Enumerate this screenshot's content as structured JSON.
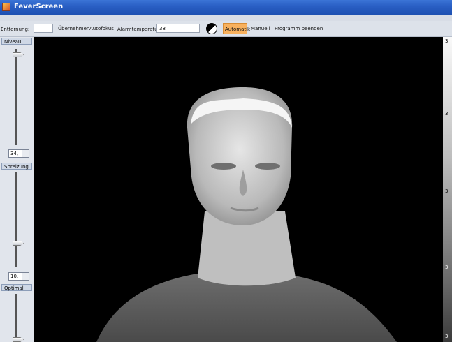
{
  "window": {
    "title": "FeverScreen"
  },
  "toolbar": {
    "distance_label": "Entfernung:",
    "distance_value": "",
    "apply_label": "Übernehmen",
    "autofocus_label": "Autofokus",
    "alarm_label": "Alarmtemperatur:",
    "alarm_value": "38",
    "automatic_label": "Automatik",
    "manual_label": "Manuell",
    "quit_label": "Programm beenden",
    "contrast_icon": "contrast-icon"
  },
  "sidebar": {
    "niveau": {
      "label": "Niveau",
      "value": "34,"
    },
    "spreizung": {
      "label": "Spreizung",
      "value": "10,"
    },
    "optimal": {
      "label": "Optimal"
    }
  },
  "scale": {
    "ticks": [
      "3",
      "3",
      "3",
      "3",
      "3"
    ]
  },
  "colors": {
    "accent": "#f8b15e",
    "title_bar": "#2a5fc4",
    "panel": "#dde2ea"
  }
}
